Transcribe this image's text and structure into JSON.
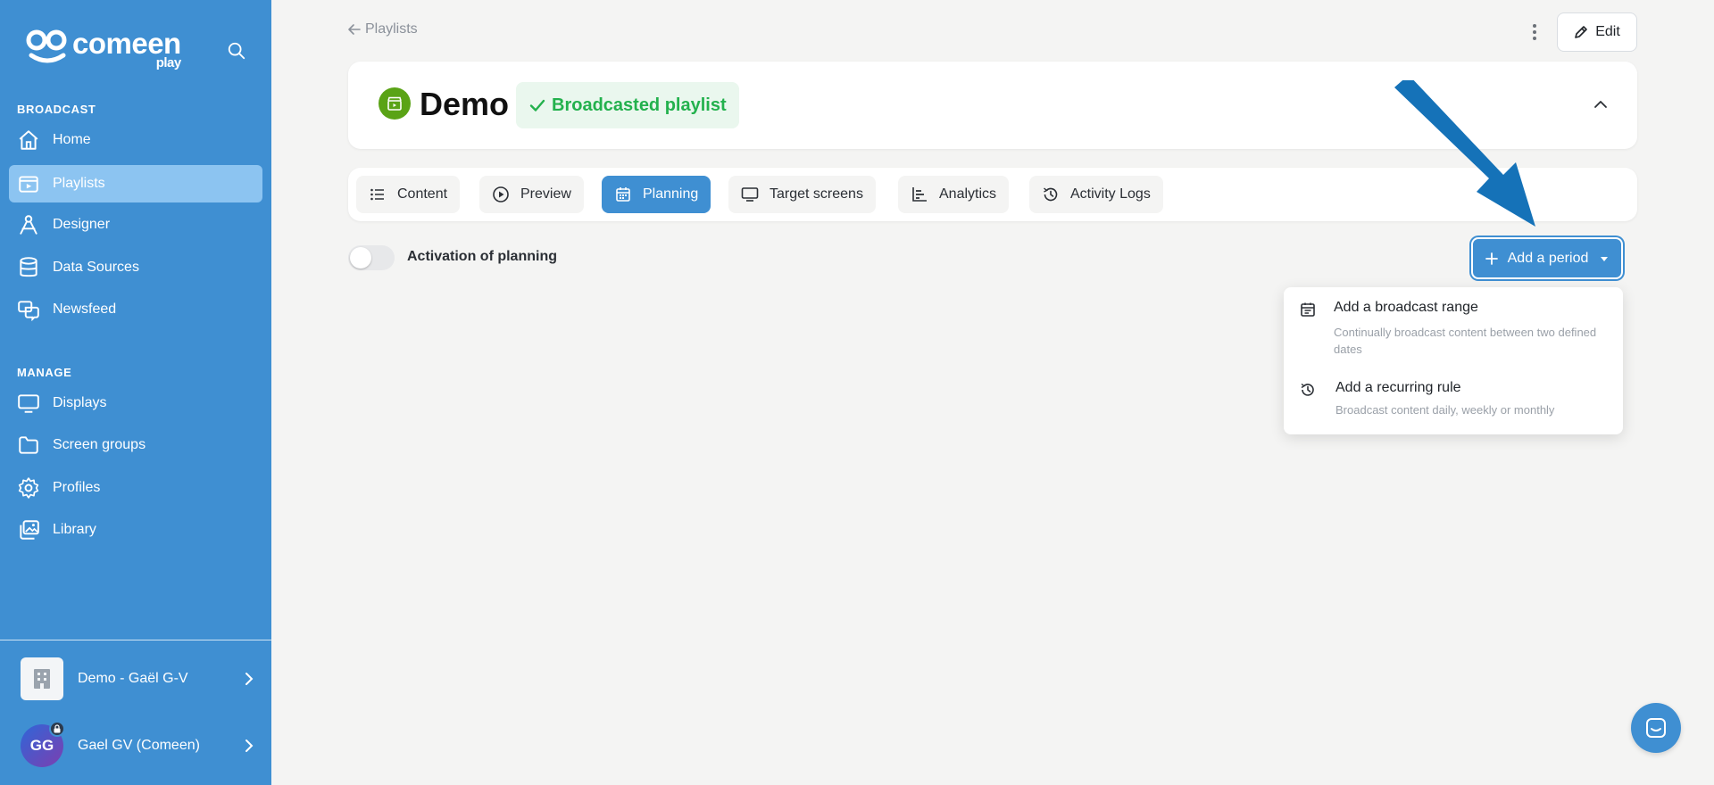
{
  "brand": {
    "name": "comeen",
    "sub": "play"
  },
  "sidebar": {
    "broadcast_title": "BROADCAST",
    "manage_title": "MANAGE",
    "broadcast_items": [
      {
        "label": "Home",
        "icon": "home-icon"
      },
      {
        "label": "Playlists",
        "icon": "playlist-icon"
      },
      {
        "label": "Designer",
        "icon": "designer-icon"
      },
      {
        "label": "Data Sources",
        "icon": "database-icon"
      },
      {
        "label": "Newsfeed",
        "icon": "newsfeed-icon"
      }
    ],
    "manage_items": [
      {
        "label": "Displays",
        "icon": "monitor-icon"
      },
      {
        "label": "Screen groups",
        "icon": "folder-icon"
      },
      {
        "label": "Profiles",
        "icon": "gear-icon"
      },
      {
        "label": "Library",
        "icon": "library-icon"
      }
    ],
    "organization": "Demo - Gaël G-V",
    "user": {
      "name": "Gael GV (Comeen)",
      "initials": "GG"
    }
  },
  "breadcrumb": {
    "back_label": "Playlists"
  },
  "toolbar": {
    "edit_label": "Edit"
  },
  "playlist": {
    "title": "Demo",
    "status": "Broadcasted playlist"
  },
  "tabs": [
    {
      "label": "Content"
    },
    {
      "label": "Preview"
    },
    {
      "label": "Planning"
    },
    {
      "label": "Target screens"
    },
    {
      "label": "Analytics"
    },
    {
      "label": "Activity Logs"
    }
  ],
  "planning": {
    "activation_label": "Activation of planning",
    "activation_on": false,
    "add_period_label": "Add a period"
  },
  "period_menu": [
    {
      "title": "Add a broadcast range",
      "desc": "Continually broadcast content between two defined dates"
    },
    {
      "title": "Add a recurring rule",
      "desc": "Broadcast content daily, weekly or monthly"
    }
  ],
  "colors": {
    "primary": "#3f8fd2",
    "active_item": "#8cc4f1",
    "success": "#23b14d",
    "arrow": "#1572b8"
  }
}
